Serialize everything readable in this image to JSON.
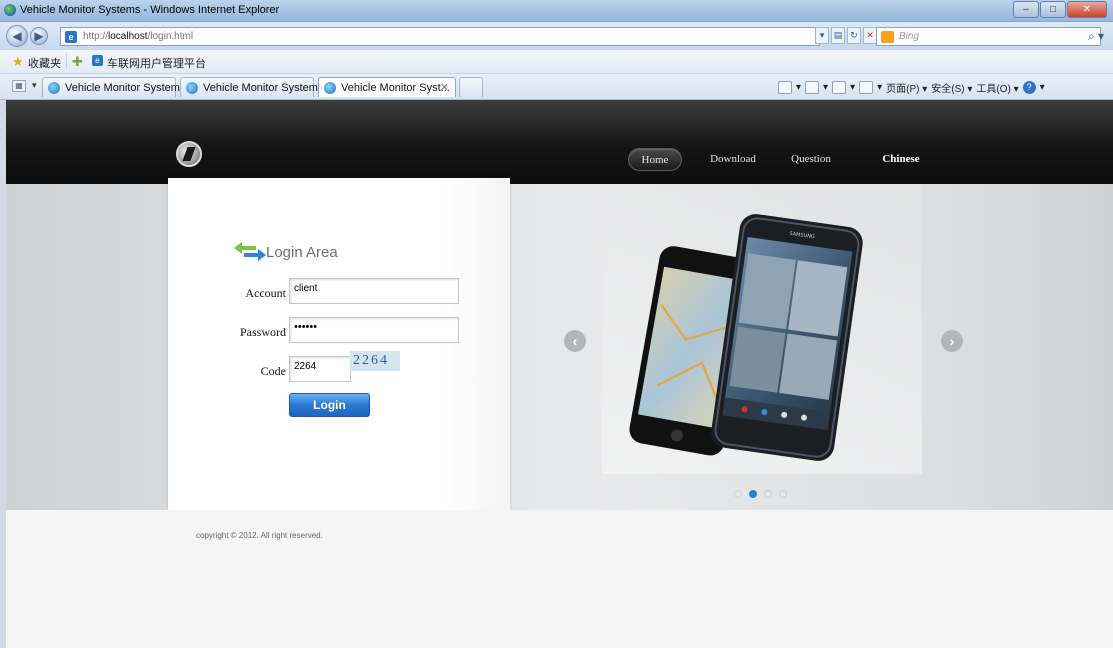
{
  "window": {
    "title": "Vehicle Monitor Systems - Windows Internet Explorer",
    "controls": [
      "minimize",
      "maximize",
      "close"
    ]
  },
  "address": {
    "url_prefix": "http://",
    "url_host": "localhost",
    "url_path": "/login.html",
    "search_placeholder": "Bing"
  },
  "favorites": {
    "label": "收藏夹",
    "link": "车联网用户管理平台"
  },
  "tabs": [
    {
      "label": "Vehicle Monitor Systems"
    },
    {
      "label": "Vehicle Monitor Systems"
    },
    {
      "label": "Vehicle Monitor Syst..."
    }
  ],
  "commandbar": {
    "page": "页面(P) ▾",
    "safety": "安全(S) ▾",
    "tools": "工具(O) ▾"
  },
  "nav": {
    "home": "Home",
    "download": "Download",
    "question": "Question",
    "chinese": "Chinese"
  },
  "login": {
    "title": "Login Area",
    "account_label": "Account",
    "account_value": "client",
    "password_label": "Password",
    "password_value": "••••••",
    "code_label": "Code",
    "code_value": "2264",
    "captcha": "2264",
    "button": "Login"
  },
  "slider": {
    "active_index": 1,
    "dot_count": 4,
    "phone_brand": "SAMSUNG"
  },
  "footer": {
    "copyright": "copyright © 2012. All right reserved."
  }
}
